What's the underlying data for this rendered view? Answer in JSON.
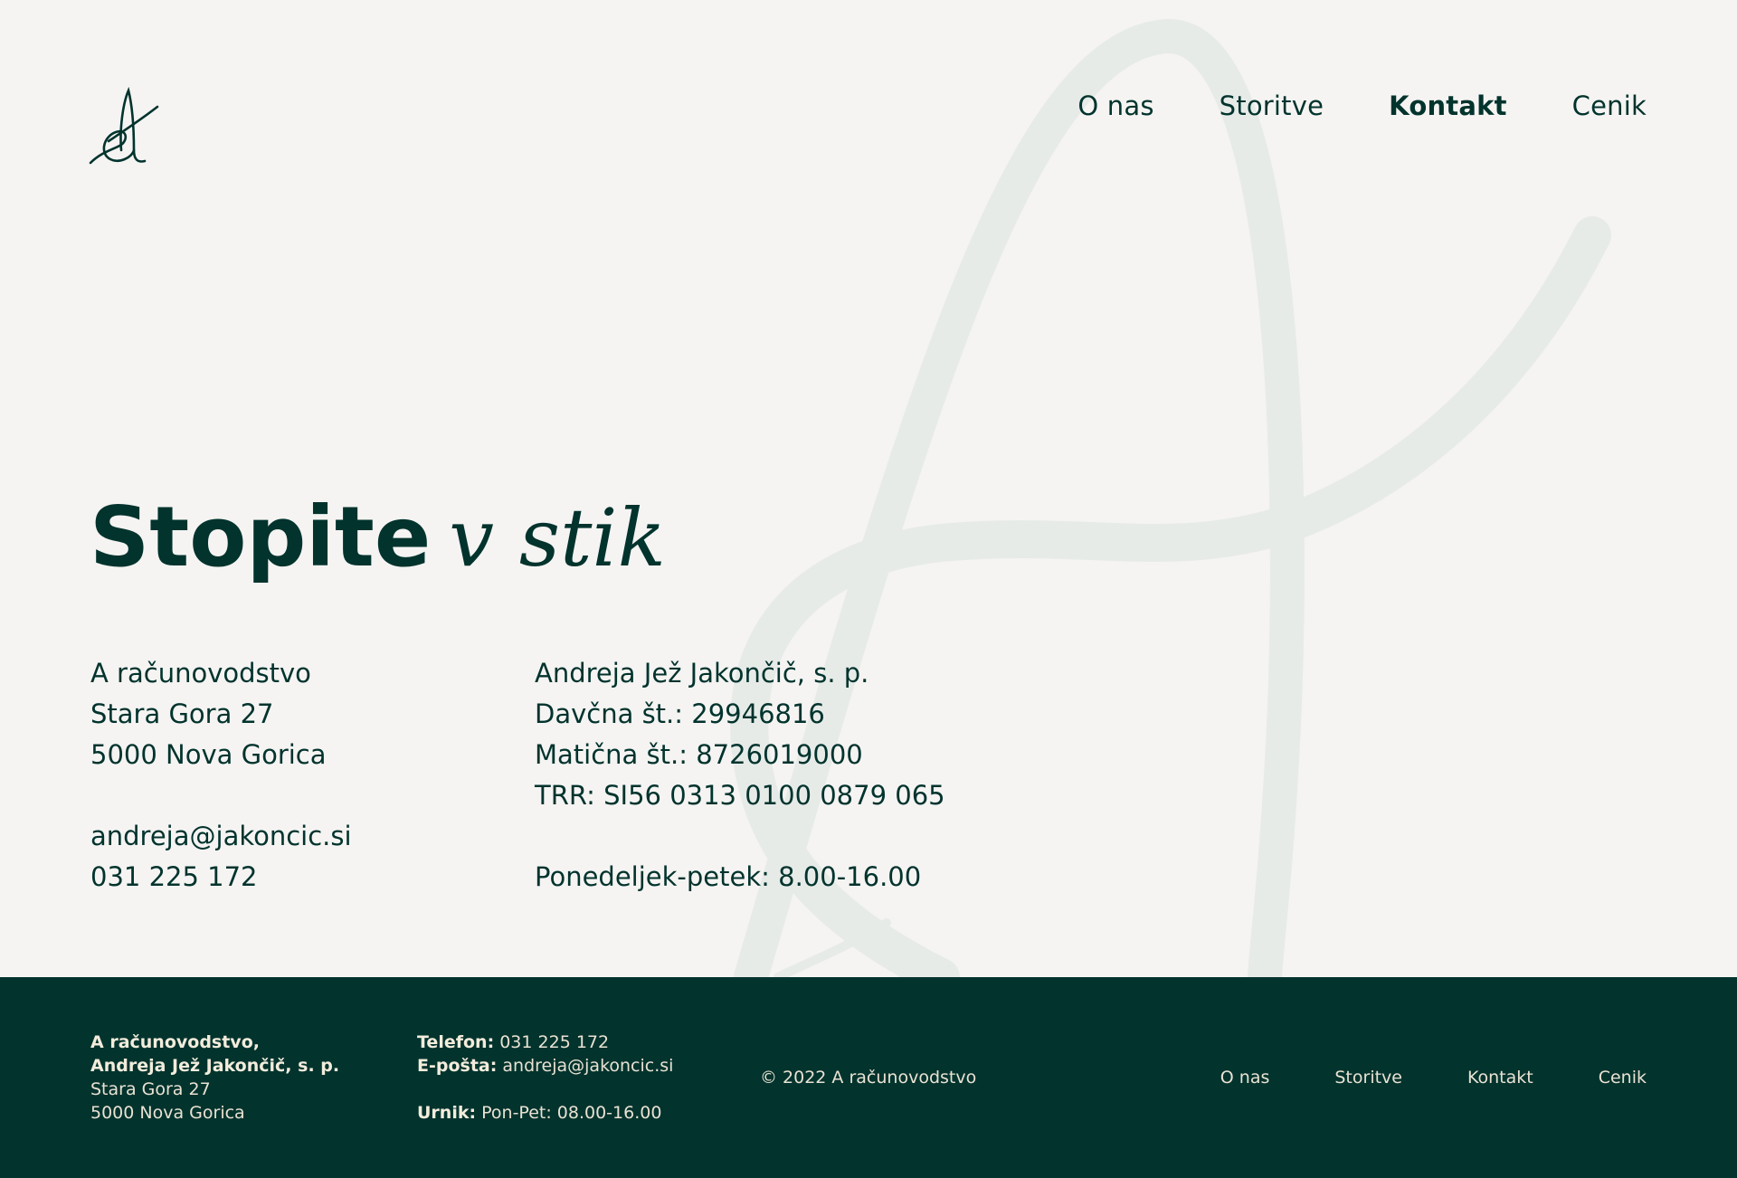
{
  "colors": {
    "primary": "#02332d",
    "background": "#f5f4f2",
    "footer_text": "#e9e2d3",
    "watermark": "#e7ebe8"
  },
  "nav": {
    "items": [
      {
        "label": "O nas",
        "active": false
      },
      {
        "label": "Storitve",
        "active": false
      },
      {
        "label": "Kontakt",
        "active": true
      },
      {
        "label": "Cenik",
        "active": false
      }
    ]
  },
  "heading": {
    "bold": "Stopite",
    "italic": "v stik"
  },
  "contact_left": {
    "company": "A računovodstvo",
    "street": "Stara Gora 27",
    "city": "5000 Nova Gorica",
    "email": "andreja@jakoncic.si",
    "phone": "031 225 172"
  },
  "contact_right": {
    "owner": "Andreja Jež Jakončič, s. p.",
    "tax": "Davčna št.: 29946816",
    "reg": "Matična št.: 8726019000",
    "iban": "TRR: SI56 0313 0100 0879 065",
    "hours": "Ponedeljek-petek: 8.00-16.00"
  },
  "footer": {
    "company_line1": "A računovodstvo,",
    "company_line2": "Andreja Jež Jakončič, s. p.",
    "street": "Stara Gora 27",
    "city": "5000 Nova Gorica",
    "phone_label": "Telefon:",
    "phone_value": "031 225 172",
    "email_label": "E-pošta:",
    "email_value": "andreja@jakoncic.si",
    "hours_label": "Urnik:",
    "hours_value": "Pon-Pet: 08.00-16.00",
    "copyright": "© 2022 A računovodstvo",
    "nav": [
      "O nas",
      "Storitve",
      "Kontakt",
      "Cenik"
    ]
  }
}
